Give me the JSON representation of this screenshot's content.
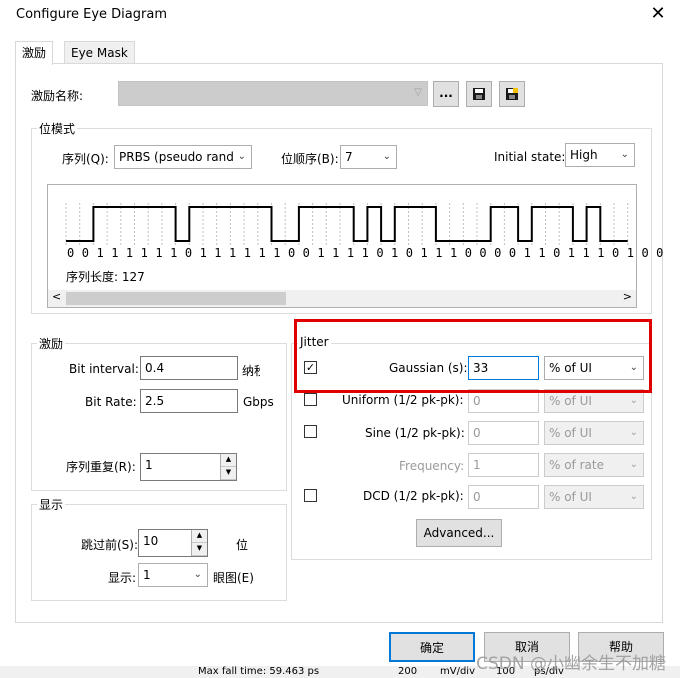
{
  "window": {
    "title": "Configure Eye Diagram",
    "close_glyph": "✕"
  },
  "tabs": [
    {
      "label": "激励"
    },
    {
      "label": "Eye Mask"
    }
  ],
  "stimulus_name": {
    "label": "激励名称:",
    "value": "",
    "browse_label": "..."
  },
  "bit_pattern": {
    "group_label": "位模式",
    "sequence_label": "序列(Q):",
    "sequence_value": "PRBS (pseudo rand",
    "bit_order_label": "位顺序(B):",
    "bit_order_value": "7",
    "initial_state_label": "Initial state:",
    "initial_state_value": "High",
    "bits_text": "0 0 1 1 1 1 1 1 0 1 1 1 1 1 1 0 0 1 1 1 1 0 1 0 1 1 1 0 0 0 0 1 1 0 1 1 1 0 1 0 0",
    "bits": [
      0,
      0,
      1,
      1,
      1,
      1,
      1,
      1,
      0,
      1,
      1,
      1,
      1,
      1,
      1,
      0,
      0,
      1,
      1,
      1,
      1,
      0,
      1,
      0,
      1,
      1,
      1,
      0,
      0,
      0,
      0,
      1,
      1,
      0,
      1,
      1,
      1,
      0,
      1,
      0,
      0
    ],
    "length_label": "序列长度: 127",
    "scroll_left_glyph": "<",
    "scroll_right_glyph": ">"
  },
  "stimulus": {
    "group_label": "激励",
    "bit_interval_label": "Bit interval:",
    "bit_interval_value": "0.4",
    "bit_interval_unit": "纳秒",
    "bit_rate_label": "Bit Rate:",
    "bit_rate_value": "2.5",
    "bit_rate_unit": "Gbps",
    "repeat_label": "序列重复(R):",
    "repeat_value": "1"
  },
  "display": {
    "group_label": "显示",
    "skip_label": "跳过前(S):",
    "skip_value": "10",
    "skip_unit": "位",
    "show_label": "显示:",
    "show_value": "1",
    "show_unit": "眼图(E)"
  },
  "jitter": {
    "group_label": "Jitter",
    "rows": [
      {
        "label": "Gaussian (s):",
        "checked": true,
        "value": "33",
        "unit": "% of UI"
      },
      {
        "label": "Uniform (1/2 pk-pk):",
        "checked": false,
        "value": "0",
        "unit": "% of UI"
      },
      {
        "label": "Sine (1/2 pk-pk):",
        "checked": false,
        "value": "0",
        "unit": "% of UI"
      },
      {
        "label": "Frequency:",
        "value": "1",
        "unit": "% of rate"
      },
      {
        "label": "DCD (1/2 pk-pk):",
        "checked": false,
        "value": "0",
        "unit": "% of UI"
      }
    ],
    "check_glyph": "✓",
    "advanced_label": "Advanced..."
  },
  "footer": {
    "ok_label": "确定",
    "cancel_label": "取消",
    "help_label": "帮助"
  },
  "background_strip": {
    "max_fall_time": "Max fall time: 59.463 ps",
    "mv_value": "200",
    "mv_unit": "mV/div",
    "ps_value": "100",
    "ps_unit": "ps/div"
  },
  "watermark": "CSDN @小幽余生不加糖",
  "colors": {
    "highlight": "#e00000",
    "focus": "#0078d7"
  }
}
